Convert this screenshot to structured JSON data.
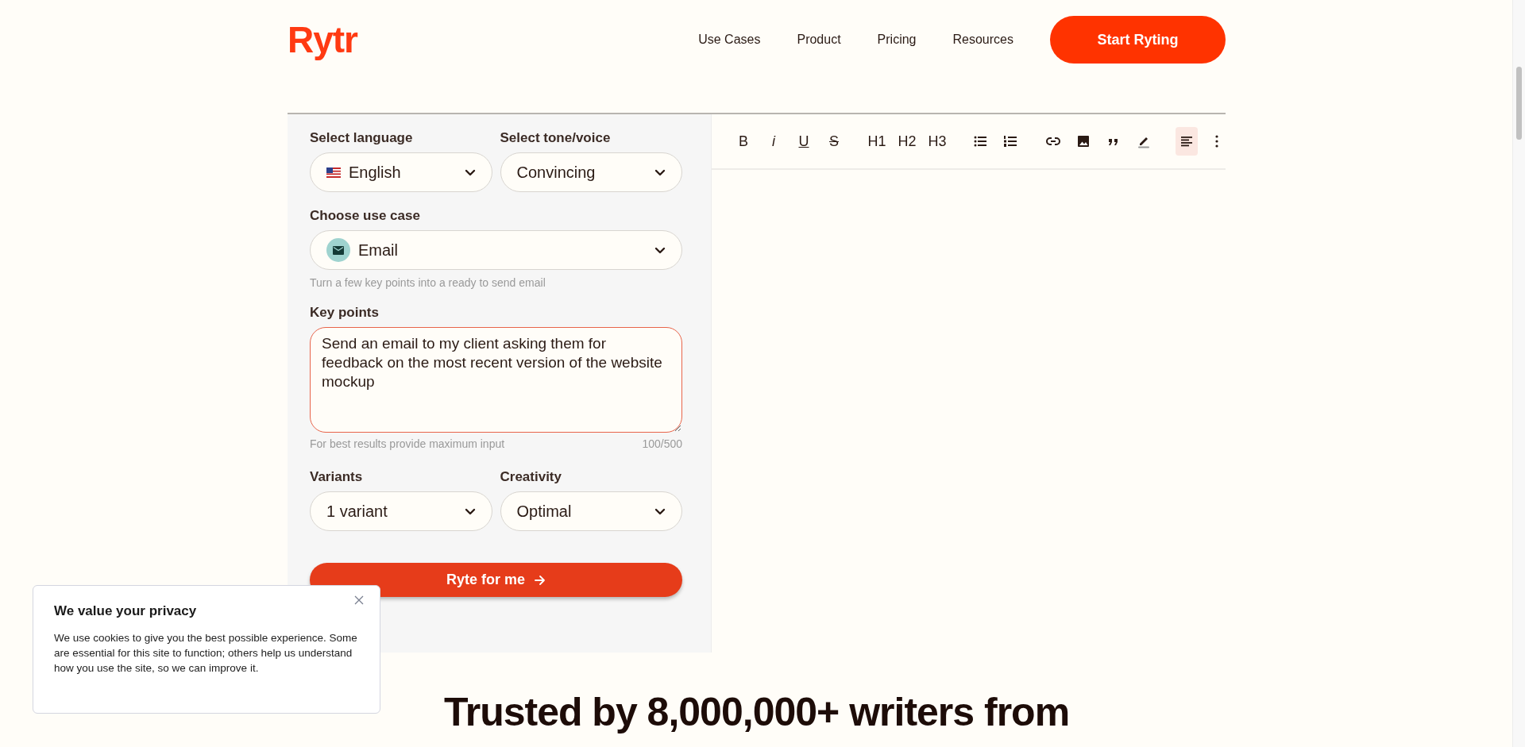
{
  "header": {
    "logo": "Rytr",
    "nav": [
      {
        "label": "Use Cases"
      },
      {
        "label": "Product"
      },
      {
        "label": "Pricing"
      },
      {
        "label": "Resources"
      }
    ],
    "cta": "Start Ryting"
  },
  "form": {
    "language": {
      "label": "Select language",
      "value": "English"
    },
    "tone": {
      "label": "Select tone/voice",
      "value": "Convincing"
    },
    "use_case": {
      "label": "Choose use case",
      "value": "Email",
      "hint": "Turn a few key points into a ready to send email"
    },
    "key_points": {
      "label": "Key points",
      "value": "Send an email to my client asking them for feedback on the most recent version of the website mockup",
      "hint": "For best results provide maximum input",
      "count": "100/500"
    },
    "variants": {
      "label": "Variants",
      "value": "1 variant"
    },
    "creativity": {
      "label": "Creativity",
      "value": "Optimal"
    },
    "submit": "Ryte for me"
  },
  "editor": {
    "toolbar": [
      {
        "kind": "bold",
        "label": "B",
        "selected": false
      },
      {
        "kind": "italic",
        "label": "i",
        "selected": false
      },
      {
        "kind": "underline",
        "label": "U",
        "selected": false
      },
      {
        "kind": "strike",
        "label": "S",
        "selected": false
      },
      {
        "kind": "heading",
        "label": "H1",
        "selected": false
      },
      {
        "kind": "heading",
        "label": "H2",
        "selected": false
      },
      {
        "kind": "heading",
        "label": "H3",
        "selected": false
      },
      {
        "kind": "bullets",
        "selected": false
      },
      {
        "kind": "numbers",
        "selected": false
      },
      {
        "kind": "link",
        "selected": false
      },
      {
        "kind": "image",
        "selected": false
      },
      {
        "kind": "quote",
        "selected": false
      },
      {
        "kind": "pen",
        "selected": false
      },
      {
        "kind": "align",
        "selected": true
      },
      {
        "kind": "more",
        "selected": false
      }
    ]
  },
  "cookie_banner": {
    "title": "We value your privacy",
    "text": "We use cookies to give you the best possible experience. Some are essential for this site to function; others help us understand how you use the site, so we can improve it."
  },
  "headline": "Trusted by 8,000,000+ writers from"
}
